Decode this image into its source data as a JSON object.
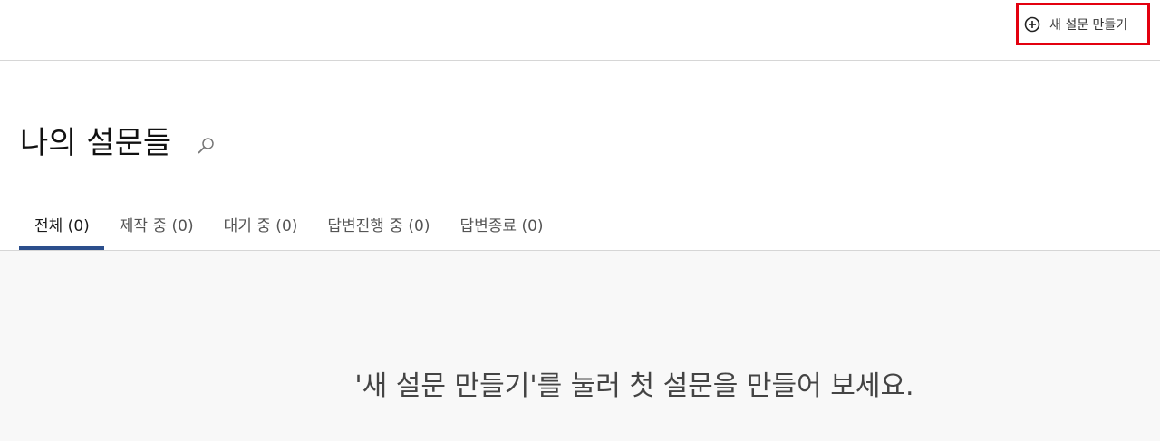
{
  "header": {
    "create_button_label": "새 설문 만들기",
    "create_button_icon": "plus-circle-icon",
    "highlight_color": "#e3000f"
  },
  "page": {
    "title": "나의 설문들",
    "search_icon": "search-icon"
  },
  "tabs": [
    {
      "label": "전체 (0)",
      "active": true
    },
    {
      "label": "제작 중 (0)",
      "active": false
    },
    {
      "label": "대기 중 (0)",
      "active": false
    },
    {
      "label": "답변진행 중 (0)",
      "active": false
    },
    {
      "label": "답변종료 (0)",
      "active": false
    }
  ],
  "accent_color": "#2b4e8c",
  "empty_state": {
    "message": "'새 설문 만들기'를 눌러 첫 설문을 만들어 보세요."
  }
}
